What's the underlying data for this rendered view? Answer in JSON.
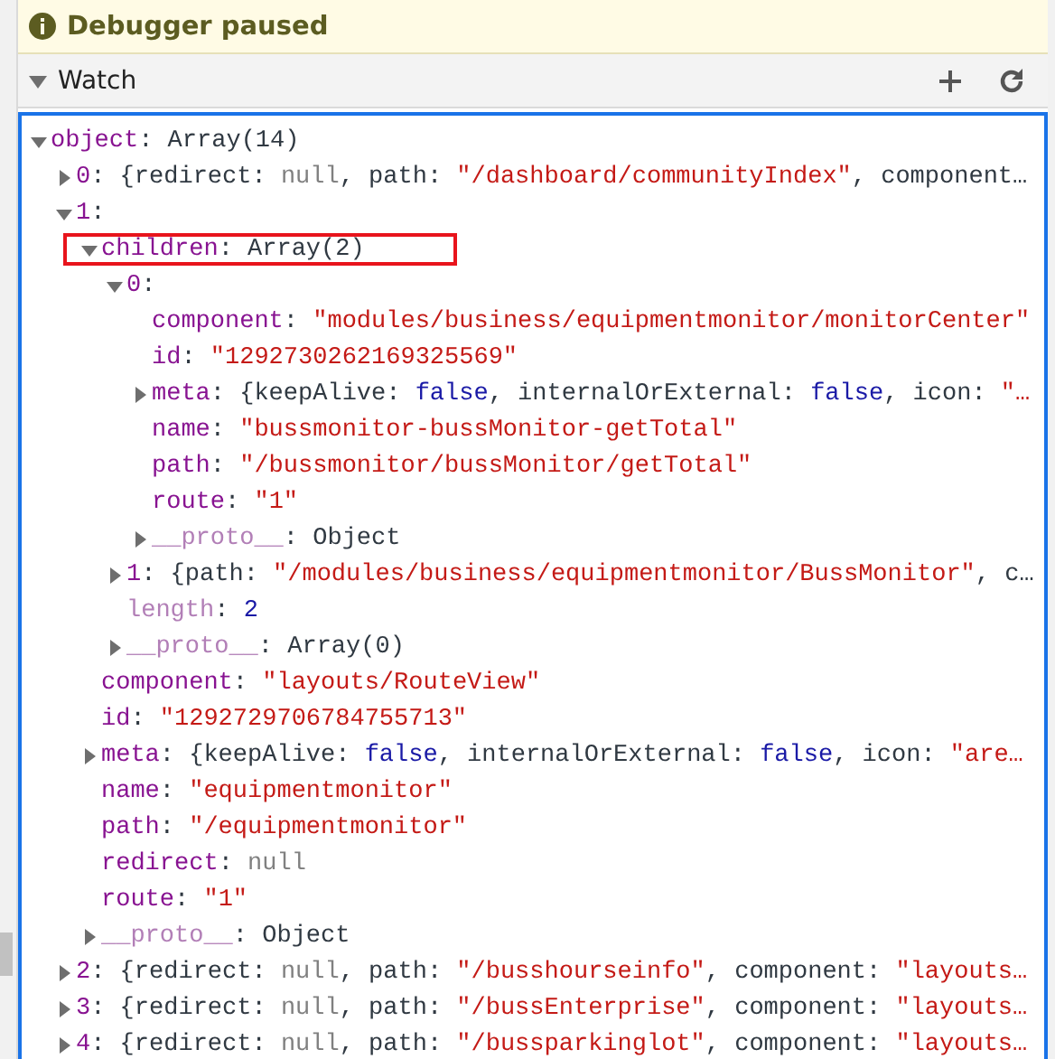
{
  "banner": {
    "text": "Debugger paused"
  },
  "watch": {
    "title": "Watch",
    "expanded": true,
    "tree": [
      {
        "key": "object",
        "dim": false,
        "expanded": true,
        "value": [
          {
            "text": ": Array(14)",
            "kind": "plain"
          }
        ],
        "children": [
          {
            "key": "0",
            "dim": false,
            "expanded": false,
            "value": [
              {
                "text": ": {redirect: ",
                "kind": "plain"
              },
              {
                "text": "null",
                "kind": "null"
              },
              {
                "text": ", path: ",
                "kind": "plain"
              },
              {
                "text": "\"/dashboard/communityIndex\"",
                "kind": "string"
              },
              {
                "text": ", component…",
                "kind": "plain"
              }
            ]
          },
          {
            "key": "1",
            "dim": false,
            "expanded": true,
            "value": [
              {
                "text": ":",
                "kind": "plain"
              }
            ],
            "children": [
              {
                "key": "children",
                "dim": false,
                "expanded": true,
                "highlighted": true,
                "value": [
                  {
                    "text": ": Array(2)",
                    "kind": "plain"
                  }
                ],
                "children": [
                  {
                    "key": "0",
                    "dim": false,
                    "expanded": true,
                    "value": [
                      {
                        "text": ":",
                        "kind": "plain"
                      }
                    ],
                    "children": [
                      {
                        "key": "component",
                        "dim": false,
                        "value": [
                          {
                            "text": ": ",
                            "kind": "plain"
                          },
                          {
                            "text": "\"modules/business/equipmentmonitor/monitorCenter\"",
                            "kind": "string"
                          }
                        ]
                      },
                      {
                        "key": "id",
                        "dim": false,
                        "value": [
                          {
                            "text": ": ",
                            "kind": "plain"
                          },
                          {
                            "text": "\"1292730262169325569\"",
                            "kind": "string"
                          }
                        ]
                      },
                      {
                        "key": "meta",
                        "dim": false,
                        "expanded": false,
                        "value": [
                          {
                            "text": ": {keepAlive: ",
                            "kind": "plain"
                          },
                          {
                            "text": "false",
                            "kind": "bool"
                          },
                          {
                            "text": ", internalOrExternal: ",
                            "kind": "plain"
                          },
                          {
                            "text": "false",
                            "kind": "bool"
                          },
                          {
                            "text": ", icon: ",
                            "kind": "plain"
                          },
                          {
                            "text": "\"…",
                            "kind": "string"
                          }
                        ]
                      },
                      {
                        "key": "name",
                        "dim": false,
                        "value": [
                          {
                            "text": ": ",
                            "kind": "plain"
                          },
                          {
                            "text": "\"bussmonitor-bussMonitor-getTotal\"",
                            "kind": "string"
                          }
                        ]
                      },
                      {
                        "key": "path",
                        "dim": false,
                        "value": [
                          {
                            "text": ": ",
                            "kind": "plain"
                          },
                          {
                            "text": "\"/bussmonitor/bussMonitor/getTotal\"",
                            "kind": "string"
                          }
                        ]
                      },
                      {
                        "key": "route",
                        "dim": false,
                        "value": [
                          {
                            "text": ": ",
                            "kind": "plain"
                          },
                          {
                            "text": "\"1\"",
                            "kind": "string"
                          }
                        ]
                      },
                      {
                        "key": "__proto__",
                        "dim": true,
                        "expanded": false,
                        "value": [
                          {
                            "text": ": Object",
                            "kind": "plain"
                          }
                        ]
                      }
                    ]
                  },
                  {
                    "key": "1",
                    "dim": false,
                    "expanded": false,
                    "value": [
                      {
                        "text": ": {path: ",
                        "kind": "plain"
                      },
                      {
                        "text": "\"/modules/business/equipmentmonitor/BussMonitor\"",
                        "kind": "string"
                      },
                      {
                        "text": ", c…",
                        "kind": "plain"
                      }
                    ]
                  },
                  {
                    "key": "length",
                    "dim": true,
                    "value": [
                      {
                        "text": ": ",
                        "kind": "plain"
                      },
                      {
                        "text": "2",
                        "kind": "number"
                      }
                    ]
                  },
                  {
                    "key": "__proto__",
                    "dim": true,
                    "expanded": false,
                    "value": [
                      {
                        "text": ": Array(0)",
                        "kind": "plain"
                      }
                    ]
                  }
                ]
              },
              {
                "key": "component",
                "dim": false,
                "value": [
                  {
                    "text": ": ",
                    "kind": "plain"
                  },
                  {
                    "text": "\"layouts/RouteView\"",
                    "kind": "string"
                  }
                ]
              },
              {
                "key": "id",
                "dim": false,
                "value": [
                  {
                    "text": ": ",
                    "kind": "plain"
                  },
                  {
                    "text": "\"1292729706784755713\"",
                    "kind": "string"
                  }
                ]
              },
              {
                "key": "meta",
                "dim": false,
                "expanded": false,
                "value": [
                  {
                    "text": ": {keepAlive: ",
                    "kind": "plain"
                  },
                  {
                    "text": "false",
                    "kind": "bool"
                  },
                  {
                    "text": ", internalOrExternal: ",
                    "kind": "plain"
                  },
                  {
                    "text": "false",
                    "kind": "bool"
                  },
                  {
                    "text": ", icon: ",
                    "kind": "plain"
                  },
                  {
                    "text": "\"are…",
                    "kind": "string"
                  }
                ]
              },
              {
                "key": "name",
                "dim": false,
                "value": [
                  {
                    "text": ": ",
                    "kind": "plain"
                  },
                  {
                    "text": "\"equipmentmonitor\"",
                    "kind": "string"
                  }
                ]
              },
              {
                "key": "path",
                "dim": false,
                "value": [
                  {
                    "text": ": ",
                    "kind": "plain"
                  },
                  {
                    "text": "\"/equipmentmonitor\"",
                    "kind": "string"
                  }
                ]
              },
              {
                "key": "redirect",
                "dim": false,
                "value": [
                  {
                    "text": ": ",
                    "kind": "plain"
                  },
                  {
                    "text": "null",
                    "kind": "null"
                  }
                ]
              },
              {
                "key": "route",
                "dim": false,
                "value": [
                  {
                    "text": ": ",
                    "kind": "plain"
                  },
                  {
                    "text": "\"1\"",
                    "kind": "string"
                  }
                ]
              },
              {
                "key": "__proto__",
                "dim": true,
                "expanded": false,
                "value": [
                  {
                    "text": ": Object",
                    "kind": "plain"
                  }
                ]
              }
            ]
          },
          {
            "key": "2",
            "dim": false,
            "expanded": false,
            "value": [
              {
                "text": ": {redirect: ",
                "kind": "plain"
              },
              {
                "text": "null",
                "kind": "null"
              },
              {
                "text": ", path: ",
                "kind": "plain"
              },
              {
                "text": "\"/busshourseinfo\"",
                "kind": "string"
              },
              {
                "text": ", component: ",
                "kind": "plain"
              },
              {
                "text": "\"layouts…",
                "kind": "string"
              }
            ]
          },
          {
            "key": "3",
            "dim": false,
            "expanded": false,
            "value": [
              {
                "text": ": {redirect: ",
                "kind": "plain"
              },
              {
                "text": "null",
                "kind": "null"
              },
              {
                "text": ", path: ",
                "kind": "plain"
              },
              {
                "text": "\"/bussEnterprise\"",
                "kind": "string"
              },
              {
                "text": ", component: ",
                "kind": "plain"
              },
              {
                "text": "\"layouts…",
                "kind": "string"
              }
            ]
          },
          {
            "key": "4",
            "dim": false,
            "expanded": false,
            "value": [
              {
                "text": ": {redirect: ",
                "kind": "plain"
              },
              {
                "text": "null",
                "kind": "null"
              },
              {
                "text": ", path: ",
                "kind": "plain"
              },
              {
                "text": "\"/bussparkinglot\"",
                "kind": "string"
              },
              {
                "text": ", component: ",
                "kind": "plain"
              },
              {
                "text": "\"layouts…",
                "kind": "string"
              }
            ]
          }
        ]
      }
    ]
  }
}
